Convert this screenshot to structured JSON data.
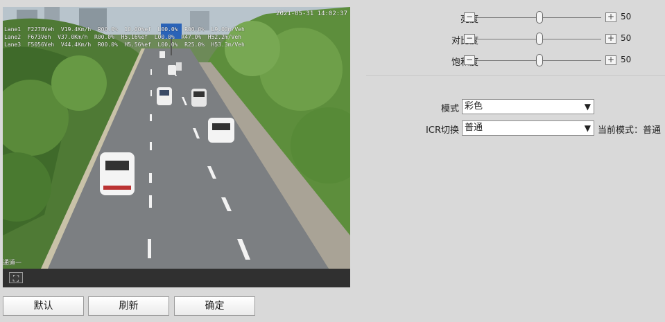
{
  "video": {
    "timestamp": "2021-05-31 14:02:37",
    "lane_lines": [
      "Lane1  F2278Veh  V19.4Km/h  R00.0%  10.00%ef  L00.0%  R00.0%  L9.00m/Veh",
      "Lane2  F673Veh  V37.0Km/h  R00.0%  H5.16%ef  L00.0%  R47.0%  H52.2m/Veh",
      "Lane3  F5056Veh  V44.4Km/h  R00.0%  H5.56%ef  L00.0%  R25.0%  H53.3m/Veh"
    ],
    "channel_label": "通道一",
    "fullscreen_icon": "fullscreen-icon"
  },
  "buttons": {
    "default": "默认",
    "refresh": "刷新",
    "confirm": "确定"
  },
  "sliders": [
    {
      "label": "亮度",
      "value": "50",
      "level": 0.5
    },
    {
      "label": "对比度",
      "value": "50",
      "level": 0.5
    },
    {
      "label": "饱和度",
      "value": "50",
      "level": 0.5
    }
  ],
  "mode": {
    "label": "模式",
    "value": "彩色"
  },
  "icr": {
    "label": "ICR切换",
    "value": "普通",
    "current_label": "当前模式：普通"
  }
}
